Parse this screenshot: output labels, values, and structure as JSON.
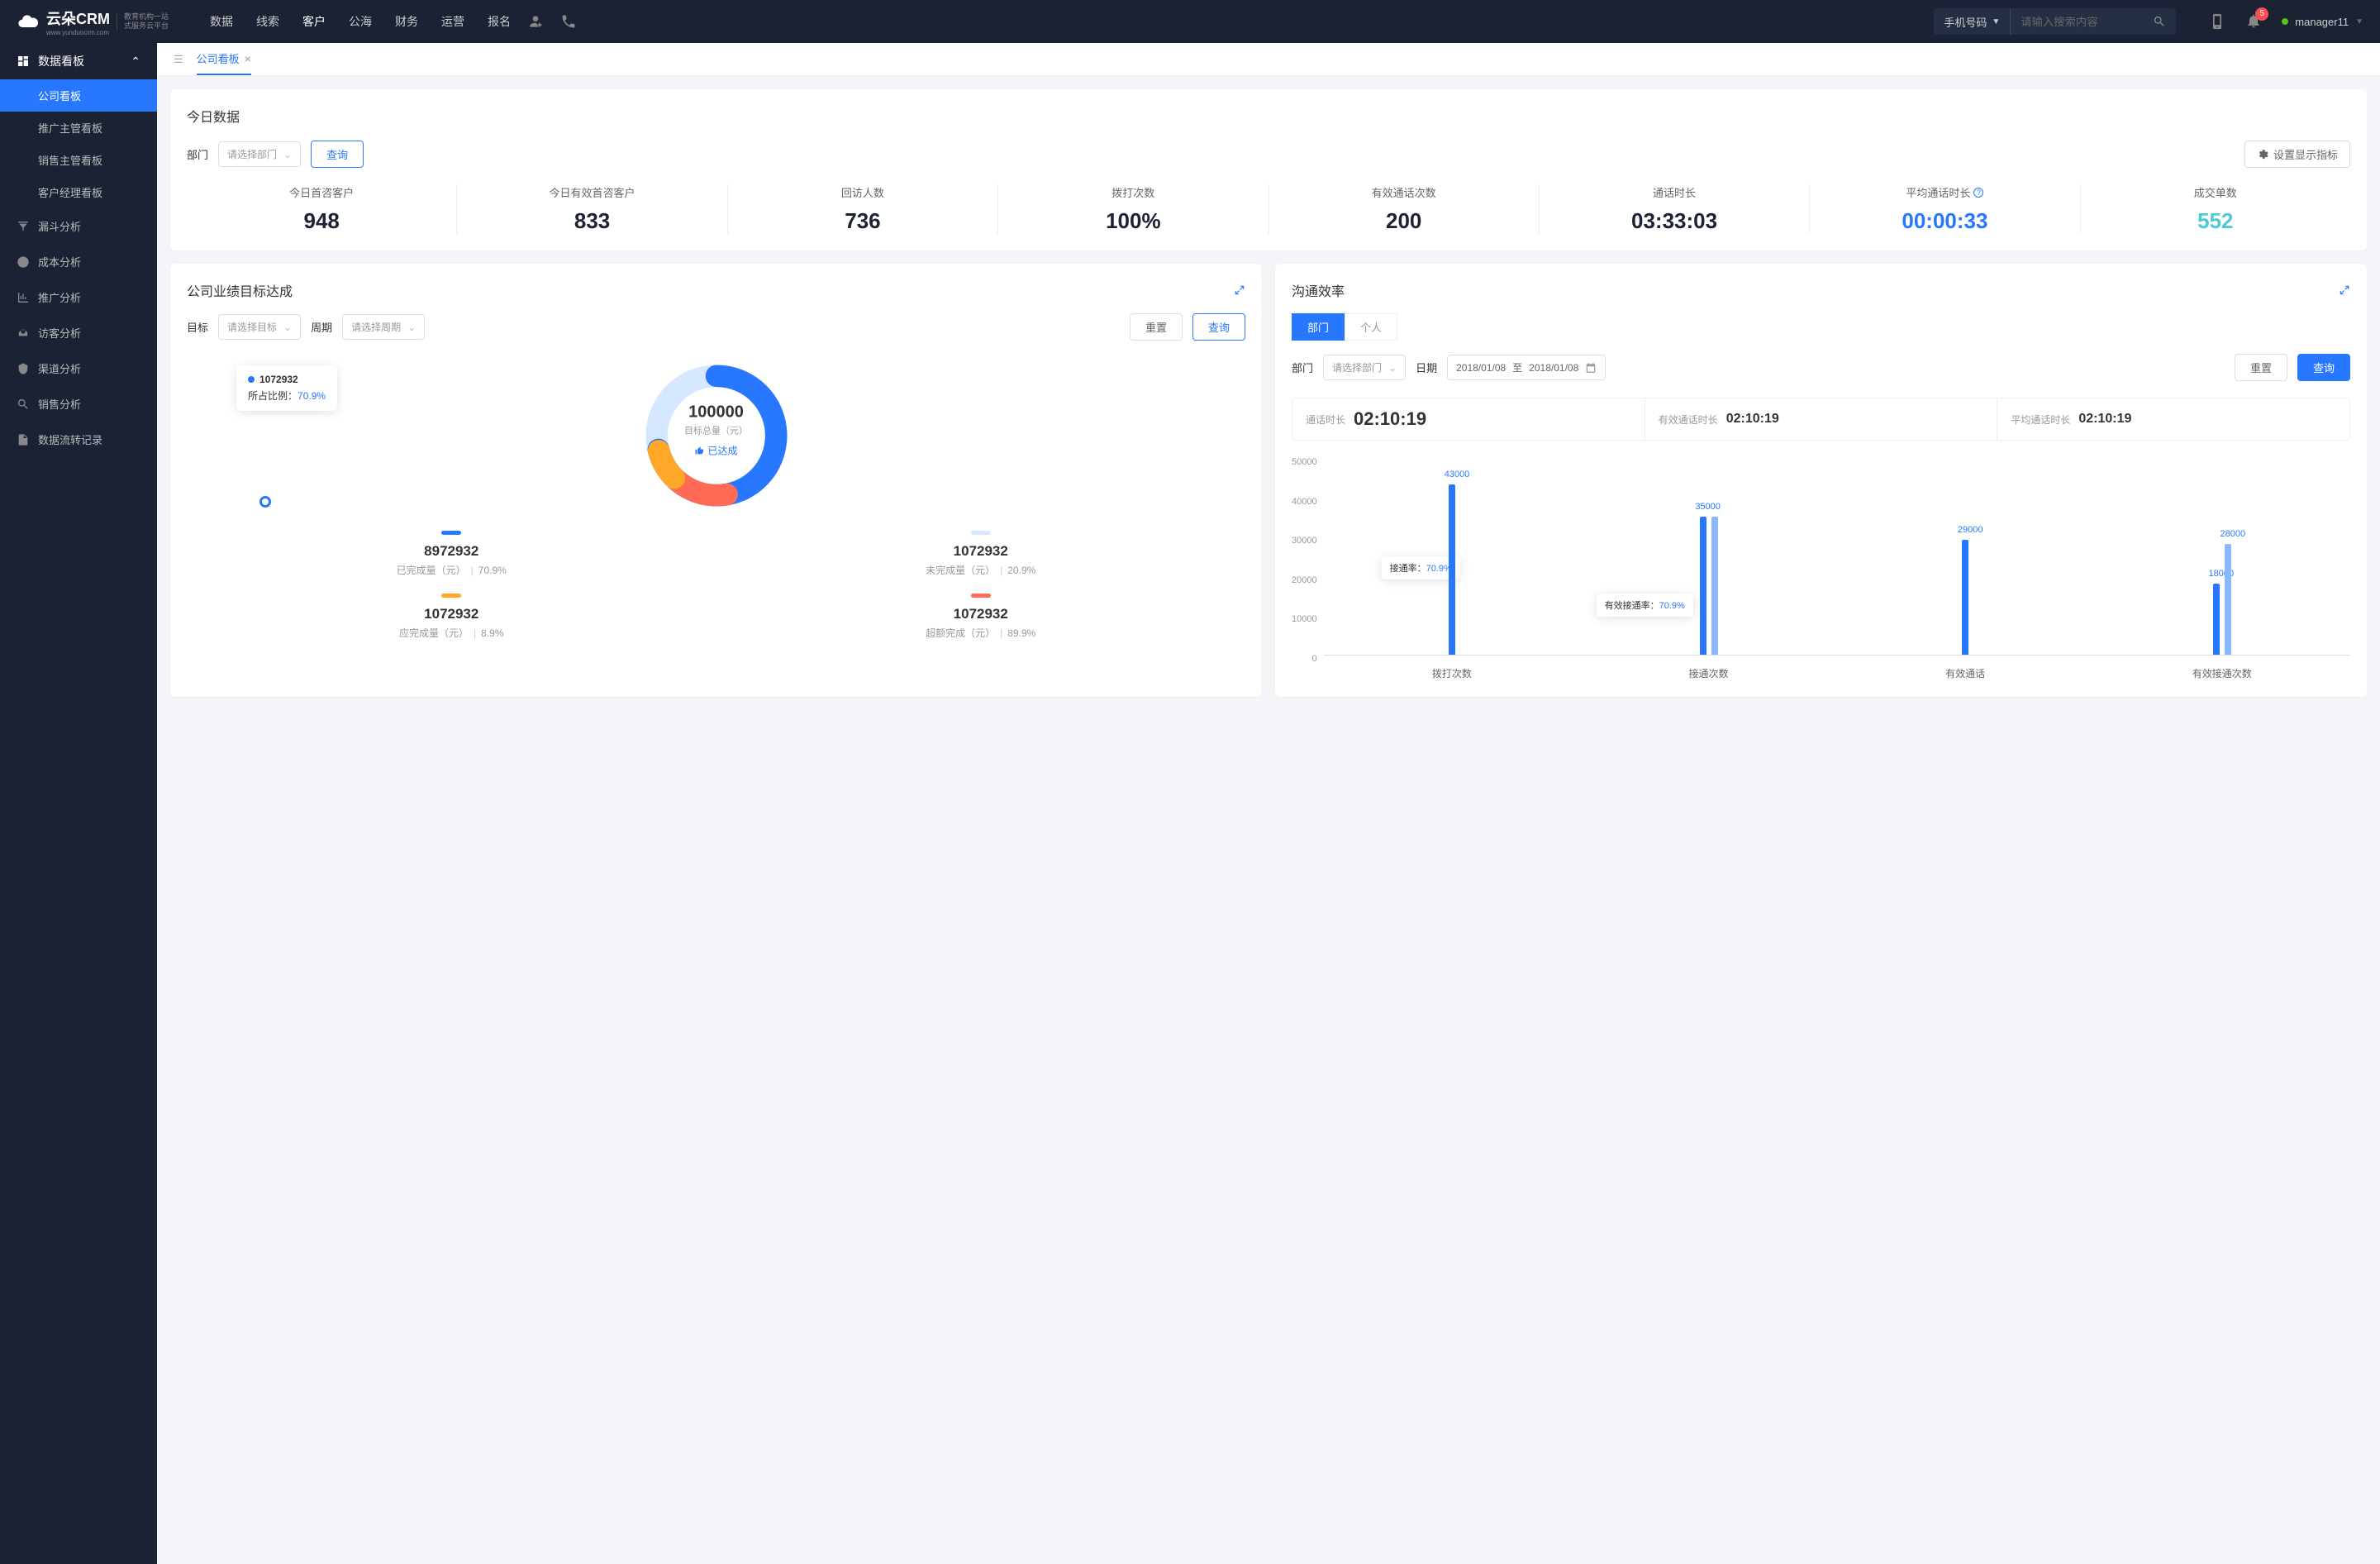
{
  "header": {
    "logo": "云朵CRM",
    "logo_url": "www.yunduocrm.com",
    "logo_sub1": "教育机构一站",
    "logo_sub2": "式服务云平台",
    "nav": [
      "数据",
      "线索",
      "客户",
      "公海",
      "财务",
      "运营",
      "报名"
    ],
    "nav_active": 2,
    "search_type": "手机号码",
    "search_placeholder": "请输入搜索内容",
    "badge": "5",
    "user": "manager11"
  },
  "sidebar": {
    "group_title": "数据看板",
    "subs": [
      "公司看板",
      "推广主管看板",
      "销售主管看板",
      "客户经理看板"
    ],
    "sub_active": 0,
    "items": [
      "漏斗分析",
      "成本分析",
      "推广分析",
      "访客分析",
      "渠道分析",
      "销售分析",
      "数据流转记录"
    ]
  },
  "tab": {
    "label": "公司看板"
  },
  "today": {
    "title": "今日数据",
    "dept_label": "部门",
    "dept_placeholder": "请选择部门",
    "query": "查询",
    "settings": "设置显示指标",
    "stats": [
      {
        "label": "今日首咨客户",
        "value": "948",
        "cls": ""
      },
      {
        "label": "今日有效首咨客户",
        "value": "833",
        "cls": ""
      },
      {
        "label": "回访人数",
        "value": "736",
        "cls": ""
      },
      {
        "label": "拨打次数",
        "value": "100%",
        "cls": ""
      },
      {
        "label": "有效通话次数",
        "value": "200",
        "cls": ""
      },
      {
        "label": "通话时长",
        "value": "03:33:03",
        "cls": ""
      },
      {
        "label": "平均通话时长",
        "value": "00:00:33",
        "cls": "stat-blue",
        "info": true
      },
      {
        "label": "成交单数",
        "value": "552",
        "cls": "stat-cyan"
      }
    ]
  },
  "target": {
    "title": "公司业绩目标达成",
    "goal_label": "目标",
    "goal_placeholder": "请选择目标",
    "period_label": "周期",
    "period_placeholder": "请选择周期",
    "reset": "重置",
    "query": "查询",
    "tooltip_value": "1072932",
    "tooltip_ratio_label": "所占比例：",
    "tooltip_ratio": "70.9%",
    "center_value": "100000",
    "center_label": "目标总量（元）",
    "done": "已达成",
    "legend": [
      {
        "color": "#2878ff",
        "value": "8972932",
        "label": "已完成量（元）",
        "pct": "70.9%"
      },
      {
        "color": "#d6e8ff",
        "value": "1072932",
        "label": "未完成量（元）",
        "pct": "20.9%"
      },
      {
        "color": "#ffa726",
        "value": "1072932",
        "label": "应完成量（元）",
        "pct": "8.9%"
      },
      {
        "color": "#ff6b57",
        "value": "1072932",
        "label": "超额完成（元）",
        "pct": "89.9%"
      }
    ]
  },
  "comm": {
    "title": "沟通效率",
    "seg": [
      "部门",
      "个人"
    ],
    "seg_active": 0,
    "dept_label": "部门",
    "dept_placeholder": "请选择部门",
    "date_label": "日期",
    "date_from": "2018/01/08",
    "date_to": "至",
    "date_end": "2018/01/08",
    "reset": "重置",
    "query": "查询",
    "times": [
      {
        "label": "通话时长",
        "value": "02:10:19",
        "big": true
      },
      {
        "label": "有效通话时长",
        "value": "02:10:19"
      },
      {
        "label": "平均通话时长",
        "value": "02:10:19"
      }
    ],
    "tooltip1_label": "接通率：",
    "tooltip1_pct": "70.9%",
    "tooltip2_label": "有效接通率：",
    "tooltip2_pct": "70.9%"
  },
  "chart_data": {
    "type": "bar",
    "ylim": [
      0,
      50000
    ],
    "yticks": [
      "50000",
      "40000",
      "30000",
      "20000",
      "10000",
      "0"
    ],
    "categories": [
      "拨打次数",
      "接通次数",
      "有效通话",
      "有效接通次数"
    ],
    "series": [
      {
        "name": "bar1",
        "color": "#2878ff",
        "values": [
          43000,
          35000,
          29000,
          18000
        ]
      },
      {
        "name": "bar2",
        "color": "#8ab8ff",
        "values": [
          null,
          35000,
          null,
          28000
        ]
      }
    ],
    "labels": [
      "43000",
      "35000",
      "29000",
      "18000"
    ]
  }
}
